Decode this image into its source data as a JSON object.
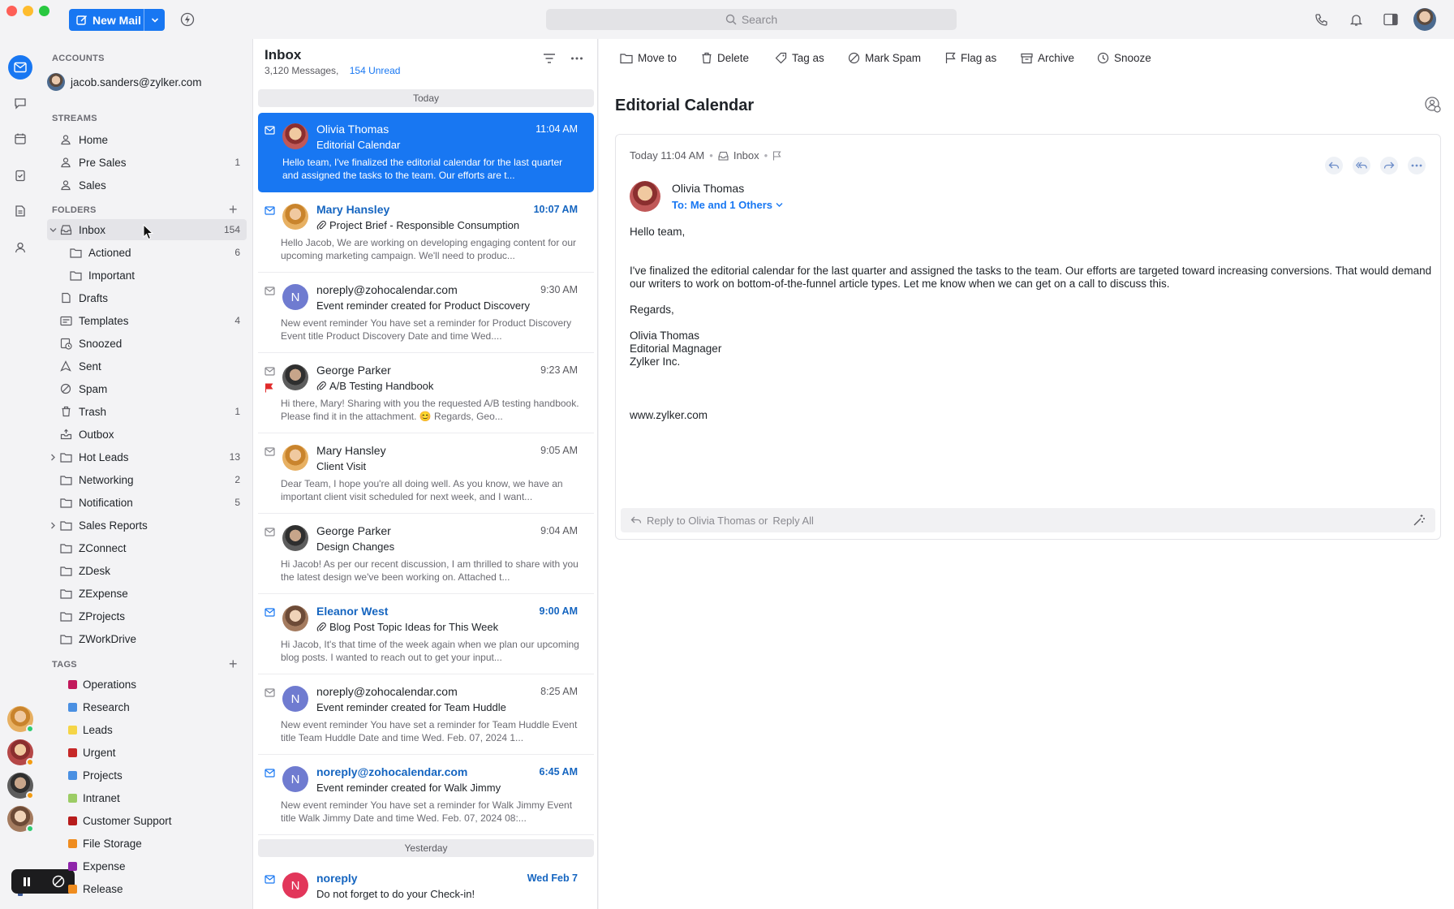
{
  "toolbar": {
    "new_mail_label": "New Mail",
    "search_placeholder": "Search"
  },
  "accounts": {
    "heading": "ACCOUNTS",
    "email": "jacob.sanders@zylker.com"
  },
  "streams": {
    "heading": "STREAMS",
    "items": [
      {
        "label": "Home",
        "count": ""
      },
      {
        "label": "Pre Sales",
        "count": "1"
      },
      {
        "label": "Sales",
        "count": ""
      }
    ]
  },
  "folders": {
    "heading": "FOLDERS",
    "items": [
      {
        "label": "Inbox",
        "count": "154"
      },
      {
        "label": "Actioned",
        "count": "6"
      },
      {
        "label": "Important",
        "count": ""
      },
      {
        "label": "Drafts",
        "count": ""
      },
      {
        "label": "Templates",
        "count": "4"
      },
      {
        "label": "Snoozed",
        "count": ""
      },
      {
        "label": "Sent",
        "count": ""
      },
      {
        "label": "Spam",
        "count": ""
      },
      {
        "label": "Trash",
        "count": "1"
      },
      {
        "label": "Outbox",
        "count": ""
      },
      {
        "label": "Hot Leads",
        "count": "13"
      },
      {
        "label": "Networking",
        "count": "2"
      },
      {
        "label": "Notification",
        "count": "5"
      },
      {
        "label": "Sales Reports",
        "count": ""
      },
      {
        "label": "ZConnect",
        "count": ""
      },
      {
        "label": "ZDesk",
        "count": ""
      },
      {
        "label": "ZExpense",
        "count": ""
      },
      {
        "label": "ZProjects",
        "count": ""
      },
      {
        "label": "ZWorkDrive",
        "count": ""
      }
    ]
  },
  "tags": {
    "heading": "TAGS",
    "items": [
      {
        "label": "Operations",
        "color": "#c2185b"
      },
      {
        "label": "Research",
        "color": "#4a90e2"
      },
      {
        "label": "Leads",
        "color": "#f5d547"
      },
      {
        "label": "Urgent",
        "color": "#c62828"
      },
      {
        "label": "Projects",
        "color": "#4a90e2"
      },
      {
        "label": "Intranet",
        "color": "#9ccc65"
      },
      {
        "label": "Customer Support",
        "color": "#b71c1c"
      },
      {
        "label": "File Storage",
        "color": "#ef8c1f"
      },
      {
        "label": "Expense",
        "color": "#8e24aa"
      },
      {
        "label": "Release",
        "color": "#ef8c1f"
      }
    ]
  },
  "list": {
    "title": "Inbox",
    "message_count": "3,120 Messages,",
    "unread_count": "154 Unread",
    "today_label": "Today",
    "yesterday_label": "Yesterday",
    "messages": [
      {
        "from": "Olivia Thomas",
        "time": "11:04 AM",
        "subject": "Editorial Calendar",
        "preview": "Hello team, I've finalized the editorial calendar for the last quarter and assigned the tasks to the team. Our efforts are t..."
      },
      {
        "from": "Mary Hansley",
        "time": "10:07 AM",
        "subject": "Project Brief - Responsible Consumption",
        "preview": "Hello Jacob, We are working on developing engaging content for our upcoming marketing campaign. We'll need to produc..."
      },
      {
        "from": "noreply@zohocalendar.com",
        "time": "9:30 AM",
        "subject": "Event reminder created for Product Discovery",
        "preview": "New event reminder You have set a reminder for Product Discovery Event title Product Discovery Date and time Wed...."
      },
      {
        "from": "George Parker",
        "time": "9:23 AM",
        "subject": "A/B Testing Handbook",
        "preview": "Hi there, Mary! Sharing with you the requested A/B testing handbook. Please find it in the attachment. 😊 Regards, Geo..."
      },
      {
        "from": "Mary Hansley",
        "time": "9:05 AM",
        "subject": "Client Visit",
        "preview": "Dear Team, I hope you're all doing well. As you know, we have an important client visit scheduled for next week, and I want..."
      },
      {
        "from": "George Parker",
        "time": "9:04 AM",
        "subject": "Design Changes",
        "preview": "Hi Jacob! As per our recent discussion, I am thrilled to share with you the latest design we've been working on. Attached t..."
      },
      {
        "from": "Eleanor West",
        "time": "9:00 AM",
        "subject": "Blog Post Topic Ideas for This Week",
        "preview": "Hi Jacob, It's that time of the week again when we plan our upcoming blog posts. I wanted to reach out to get your input..."
      },
      {
        "from": "noreply@zohocalendar.com",
        "time": "8:25 AM",
        "subject": "Event reminder created for Team Huddle",
        "preview": "New event reminder You have set a reminder for Team Huddle Event title Team Huddle Date and time Wed. Feb. 07, 2024 1..."
      },
      {
        "from": "noreply@zohocalendar.com",
        "time": "6:45 AM",
        "subject": "Event reminder created for Walk Jimmy",
        "preview": "New event reminder You have set a reminder for Walk Jimmy Event title Walk Jimmy Date and time Wed. Feb. 07, 2024 08:..."
      },
      {
        "from": "noreply",
        "time": "Wed Feb 7",
        "subject": "Do not forget to do your Check-in!",
        "preview": ""
      }
    ]
  },
  "actions": [
    "Move to",
    "Delete",
    "Tag as",
    "Mark Spam",
    "Flag as",
    "Archive",
    "Snooze"
  ],
  "email": {
    "subject": "Editorial Calendar",
    "date": "Today 11:04 AM",
    "folder": "Inbox",
    "sender": "Olivia Thomas",
    "to": "To: Me and 1 Others",
    "greeting": "Hello team,",
    "body": "I've finalized the editorial calendar for the last quarter and assigned the tasks to the team. Our efforts are targeted toward increasing conversions. That would demand our writers to work on bottom-of-the-funnel article types. Let me know when we can get on a call to discuss this.",
    "regards": "Regards,",
    "sig_name": "Olivia Thomas",
    "sig_title": "Editorial Magnager",
    "sig_company": "Zylker Inc.",
    "website": "www.zylker.com",
    "reply_text": "Reply to Olivia Thomas or",
    "reply_all_text": "Reply All"
  }
}
